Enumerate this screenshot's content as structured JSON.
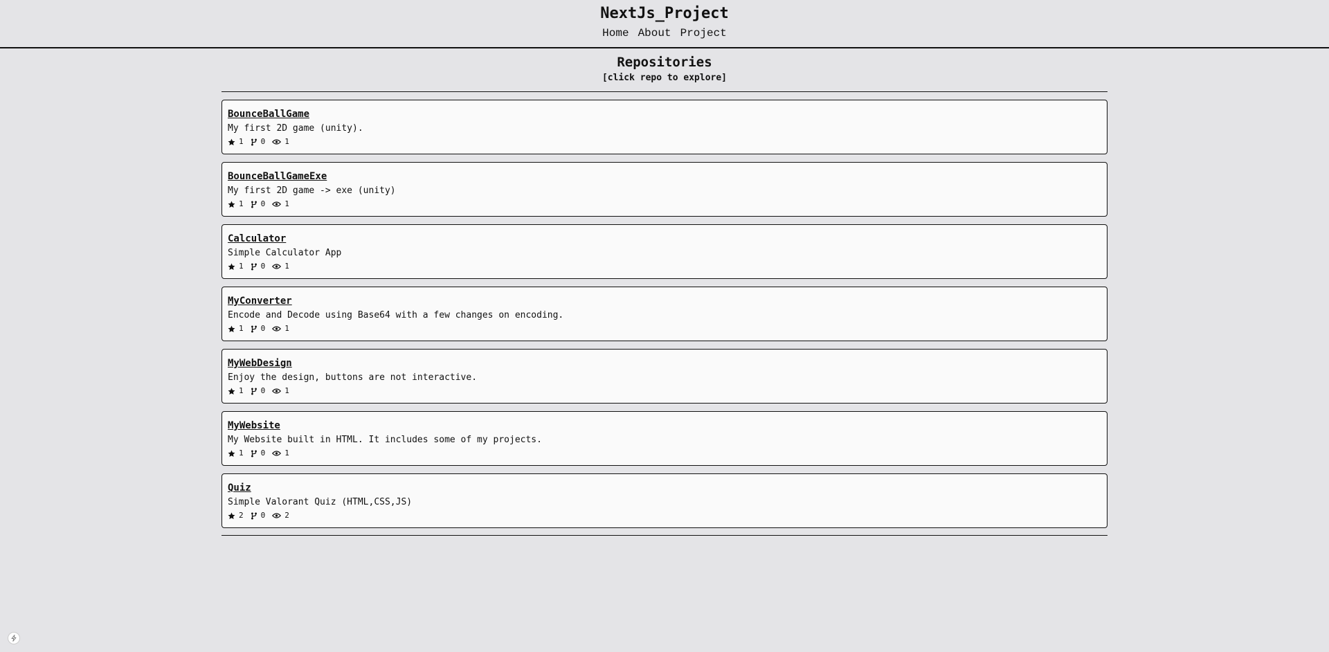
{
  "site": {
    "title": "NextJs_Project",
    "nav": [
      "Home",
      "About",
      "Project"
    ]
  },
  "page": {
    "title": "Repositories",
    "subtitle": "[click repo to explore]"
  },
  "repos": [
    {
      "name": "BounceBallGame",
      "description": "My first 2D game (unity).",
      "stars": "1",
      "forks": "0",
      "watchers": "1"
    },
    {
      "name": "BounceBallGameExe",
      "description": "My first 2D game -> exe (unity)",
      "stars": "1",
      "forks": "0",
      "watchers": "1"
    },
    {
      "name": "Calculator",
      "description": "Simple Calculator App",
      "stars": "1",
      "forks": "0",
      "watchers": "1"
    },
    {
      "name": "MyConverter",
      "description": "Encode and Decode using Base64 with a few changes on encoding.",
      "stars": "1",
      "forks": "0",
      "watchers": "1"
    },
    {
      "name": "MyWebDesign",
      "description": "Enjoy the design, buttons are not interactive.",
      "stars": "1",
      "forks": "0",
      "watchers": "1"
    },
    {
      "name": "MyWebsite",
      "description": "My Website built in HTML. It includes some of my projects.",
      "stars": "1",
      "forks": "0",
      "watchers": "1"
    },
    {
      "name": "Quiz",
      "description": "Simple Valorant Quiz (HTML,CSS,JS)",
      "stars": "2",
      "forks": "0",
      "watchers": "2"
    }
  ],
  "icons": {
    "stars": "star-icon",
    "forks": "fork-icon",
    "watchers": "eye-icon",
    "corner": "lightning-icon"
  }
}
